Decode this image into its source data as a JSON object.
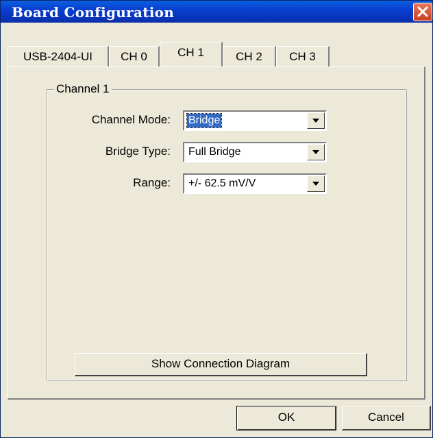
{
  "window": {
    "title": "Board Configuration"
  },
  "tabs": [
    {
      "label": "USB-2404-UI"
    },
    {
      "label": "CH 0"
    },
    {
      "label": "CH 1"
    },
    {
      "label": "CH 2"
    },
    {
      "label": "CH 3"
    }
  ],
  "group": {
    "label": "Channel 1",
    "channel_mode": {
      "label": "Channel Mode:",
      "value": "Bridge"
    },
    "bridge_type": {
      "label": "Bridge Type:",
      "value": "Full Bridge"
    },
    "range": {
      "label": "Range:",
      "value": "+/- 62.5 mV/V"
    },
    "diagram_button": "Show Connection Diagram"
  },
  "buttons": {
    "ok": "OK",
    "cancel": "Cancel"
  },
  "colors": {
    "titlebar": "#0a3fd0",
    "selection": "#316ac5",
    "face": "#ece9d8",
    "close": "#d4532e"
  }
}
